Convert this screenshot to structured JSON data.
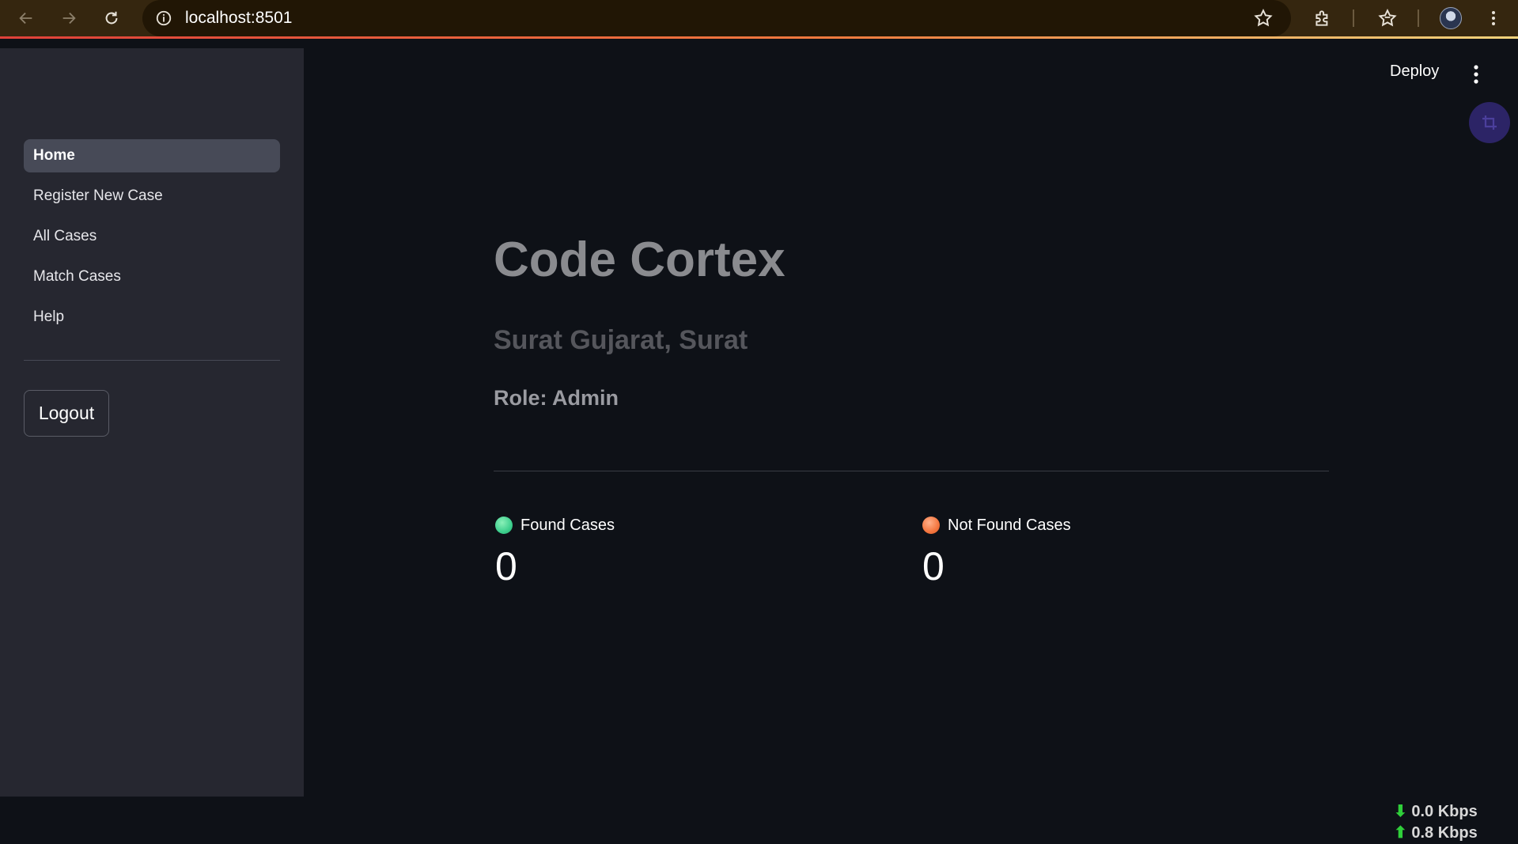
{
  "browser": {
    "url": "localhost:8501",
    "icons": [
      "back-arrow-icon",
      "forward-arrow-icon",
      "reload-icon",
      "site-info-icon",
      "bookmark-star-icon",
      "extensions-icon",
      "bookmarks-icon",
      "profile-avatar",
      "chrome-menu-icon"
    ],
    "accent_colors": [
      "#e0413a",
      "#f07a3e",
      "#f3d37b"
    ]
  },
  "sidebar": {
    "items": [
      {
        "label": "Home",
        "active": true
      },
      {
        "label": "Register New Case",
        "active": false
      },
      {
        "label": "All Cases",
        "active": false
      },
      {
        "label": "Match Cases",
        "active": false
      },
      {
        "label": "Help",
        "active": false
      }
    ],
    "logout_label": "Logout"
  },
  "header": {
    "deploy_label": "Deploy"
  },
  "main": {
    "title": "Code Cortex",
    "location": "Surat Gujarat, Surat",
    "role": "Role: Admin",
    "metrics": [
      {
        "label": "Found Cases",
        "value": "0",
        "dot_color": "#3ecf8e"
      },
      {
        "label": "Not Found Cases",
        "value": "0",
        "dot_color": "#f4763f"
      }
    ]
  },
  "net_speed": {
    "down": "0.0 Kbps",
    "up": "0.8 Kbps"
  }
}
